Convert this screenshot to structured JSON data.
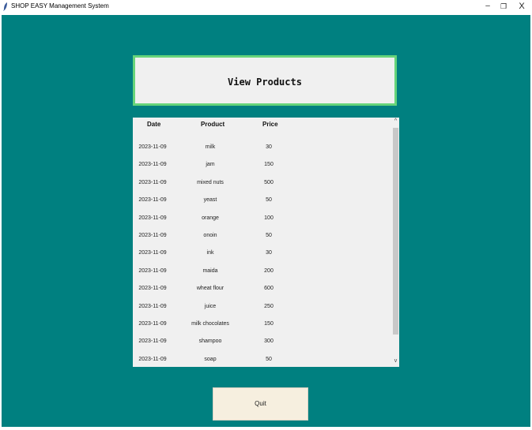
{
  "window": {
    "title": "SHOP EASY Management System",
    "controls": {
      "minimize": "–",
      "maximize": "❐",
      "close": "X"
    }
  },
  "header": {
    "title": "View Products"
  },
  "table": {
    "columns": [
      "Date",
      "Product",
      "Price"
    ],
    "rows": [
      [
        "2023-11-09",
        "milk",
        "30"
      ],
      [
        "2023-11-09",
        "jam",
        "150"
      ],
      [
        "2023-11-09",
        "mixed nuts",
        "500"
      ],
      [
        "2023-11-09",
        "yeast",
        "50"
      ],
      [
        "2023-11-09",
        "orange",
        "100"
      ],
      [
        "2023-11-09",
        "onoin",
        "50"
      ],
      [
        "2023-11-09",
        "ink",
        "30"
      ],
      [
        "2023-11-09",
        "maida",
        "200"
      ],
      [
        "2023-11-09",
        "wheat flour",
        "600"
      ],
      [
        "2023-11-09",
        "juice",
        "250"
      ],
      [
        "2023-11-09",
        "milk chocolates",
        "150"
      ],
      [
        "2023-11-09",
        "shampoo",
        "300"
      ],
      [
        "2023-11-09",
        "soap",
        "50"
      ]
    ]
  },
  "scrollbar": {
    "up": "^",
    "down": "v"
  },
  "actions": {
    "quit_label": "Quit"
  },
  "colors": {
    "background": "#008080",
    "header_border": "#66d47a",
    "panel": "#f0f0f0",
    "button": "#f6efdf"
  }
}
